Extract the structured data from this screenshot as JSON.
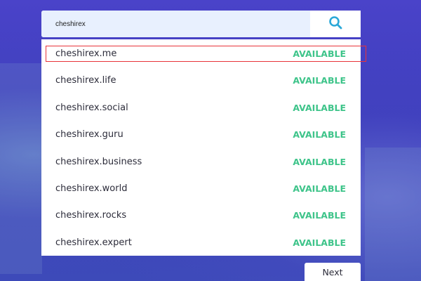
{
  "search": {
    "value": "cheshirex",
    "icon": "search-icon"
  },
  "results": [
    {
      "domain": "cheshirex.me",
      "status": "AVAILABLE"
    },
    {
      "domain": "cheshirex.life",
      "status": "AVAILABLE"
    },
    {
      "domain": "cheshirex.social",
      "status": "AVAILABLE"
    },
    {
      "domain": "cheshirex.guru",
      "status": "AVAILABLE"
    },
    {
      "domain": "cheshirex.business",
      "status": "AVAILABLE"
    },
    {
      "domain": "cheshirex.world",
      "status": "AVAILABLE"
    },
    {
      "domain": "cheshirex.rocks",
      "status": "AVAILABLE"
    },
    {
      "domain": "cheshirex.expert",
      "status": "AVAILABLE"
    }
  ],
  "next_label": "Next",
  "colors": {
    "available": "#3ec48a",
    "search_icon": "#2aa8d8",
    "highlight": "#e8333a",
    "background": "#3a3ab8"
  }
}
